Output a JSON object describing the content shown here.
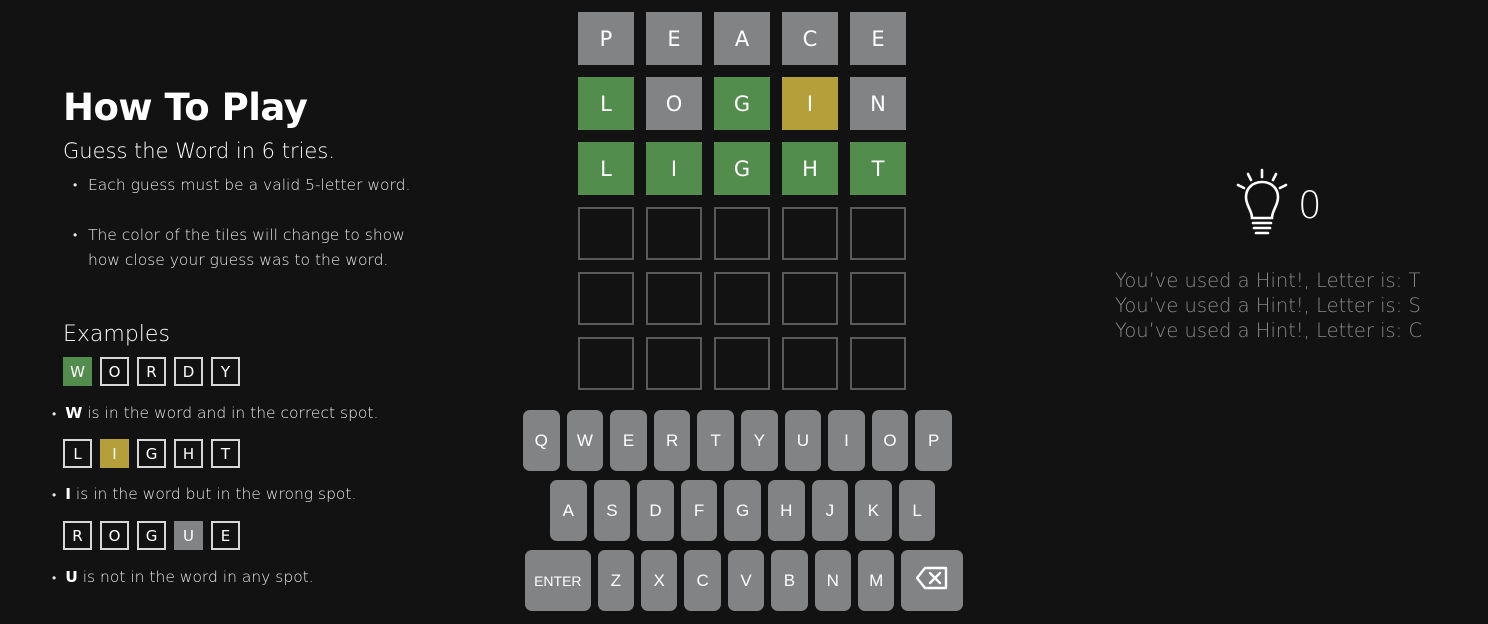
{
  "how_to_play": {
    "title": "How To Play",
    "subtitle": "Guess the Word in 6 tries.",
    "rules": [
      "Each guess must be a valid 5-letter word.",
      "The color of the tiles will change to show how close your guess was to the word."
    ],
    "examples_title": "Examples",
    "examples": [
      {
        "tiles": [
          {
            "letter": "W",
            "state": "correct"
          },
          {
            "letter": "O",
            "state": "empty"
          },
          {
            "letter": "R",
            "state": "empty"
          },
          {
            "letter": "D",
            "state": "empty"
          },
          {
            "letter": "Y",
            "state": "empty"
          }
        ],
        "key_letter": "W",
        "text": "is in the word and in the correct spot."
      },
      {
        "tiles": [
          {
            "letter": "L",
            "state": "empty"
          },
          {
            "letter": "I",
            "state": "present"
          },
          {
            "letter": "G",
            "state": "empty"
          },
          {
            "letter": "H",
            "state": "empty"
          },
          {
            "letter": "T",
            "state": "empty"
          }
        ],
        "key_letter": "I",
        "text": "is in the word but in the wrong spot."
      },
      {
        "tiles": [
          {
            "letter": "R",
            "state": "empty"
          },
          {
            "letter": "O",
            "state": "empty"
          },
          {
            "letter": "G",
            "state": "empty"
          },
          {
            "letter": "U",
            "state": "absent"
          },
          {
            "letter": "E",
            "state": "empty"
          }
        ],
        "key_letter": "U",
        "text": "is not in the word in any spot."
      }
    ]
  },
  "board": [
    [
      {
        "l": "P",
        "s": "absent"
      },
      {
        "l": "E",
        "s": "absent"
      },
      {
        "l": "A",
        "s": "absent"
      },
      {
        "l": "C",
        "s": "absent"
      },
      {
        "l": "E",
        "s": "absent"
      }
    ],
    [
      {
        "l": "L",
        "s": "correct"
      },
      {
        "l": "O",
        "s": "absent"
      },
      {
        "l": "G",
        "s": "correct"
      },
      {
        "l": "I",
        "s": "present"
      },
      {
        "l": "N",
        "s": "absent"
      }
    ],
    [
      {
        "l": "L",
        "s": "correct"
      },
      {
        "l": "I",
        "s": "correct"
      },
      {
        "l": "G",
        "s": "correct"
      },
      {
        "l": "H",
        "s": "correct"
      },
      {
        "l": "T",
        "s": "correct"
      }
    ],
    [
      {
        "l": "",
        "s": "empty"
      },
      {
        "l": "",
        "s": "empty"
      },
      {
        "l": "",
        "s": "empty"
      },
      {
        "l": "",
        "s": "empty"
      },
      {
        "l": "",
        "s": "empty"
      }
    ],
    [
      {
        "l": "",
        "s": "empty"
      },
      {
        "l": "",
        "s": "empty"
      },
      {
        "l": "",
        "s": "empty"
      },
      {
        "l": "",
        "s": "empty"
      },
      {
        "l": "",
        "s": "empty"
      }
    ],
    [
      {
        "l": "",
        "s": "empty"
      },
      {
        "l": "",
        "s": "empty"
      },
      {
        "l": "",
        "s": "empty"
      },
      {
        "l": "",
        "s": "empty"
      },
      {
        "l": "",
        "s": "empty"
      }
    ]
  ],
  "keyboard": {
    "rows": [
      [
        "Q",
        "W",
        "E",
        "R",
        "T",
        "Y",
        "U",
        "I",
        "O",
        "P"
      ],
      [
        "A",
        "S",
        "D",
        "F",
        "G",
        "H",
        "J",
        "K",
        "L"
      ],
      [
        "ENTER",
        "Z",
        "X",
        "C",
        "V",
        "B",
        "N",
        "M",
        "BACKSPACE"
      ]
    ],
    "enter_label": "ENTER",
    "backspace_icon": "backspace-icon"
  },
  "hints": {
    "icon": "lightbulb-icon",
    "count": "0",
    "log": [
      "You’ve used a Hint!, Letter is: T",
      "You’ve used a Hint!, Letter is: S",
      "You’ve used a Hint!, Letter is: C"
    ]
  },
  "colors": {
    "background": "#121212",
    "correct": "#538d4e",
    "present": "#b59f3b",
    "absent": "#818384",
    "key": "#818384"
  }
}
